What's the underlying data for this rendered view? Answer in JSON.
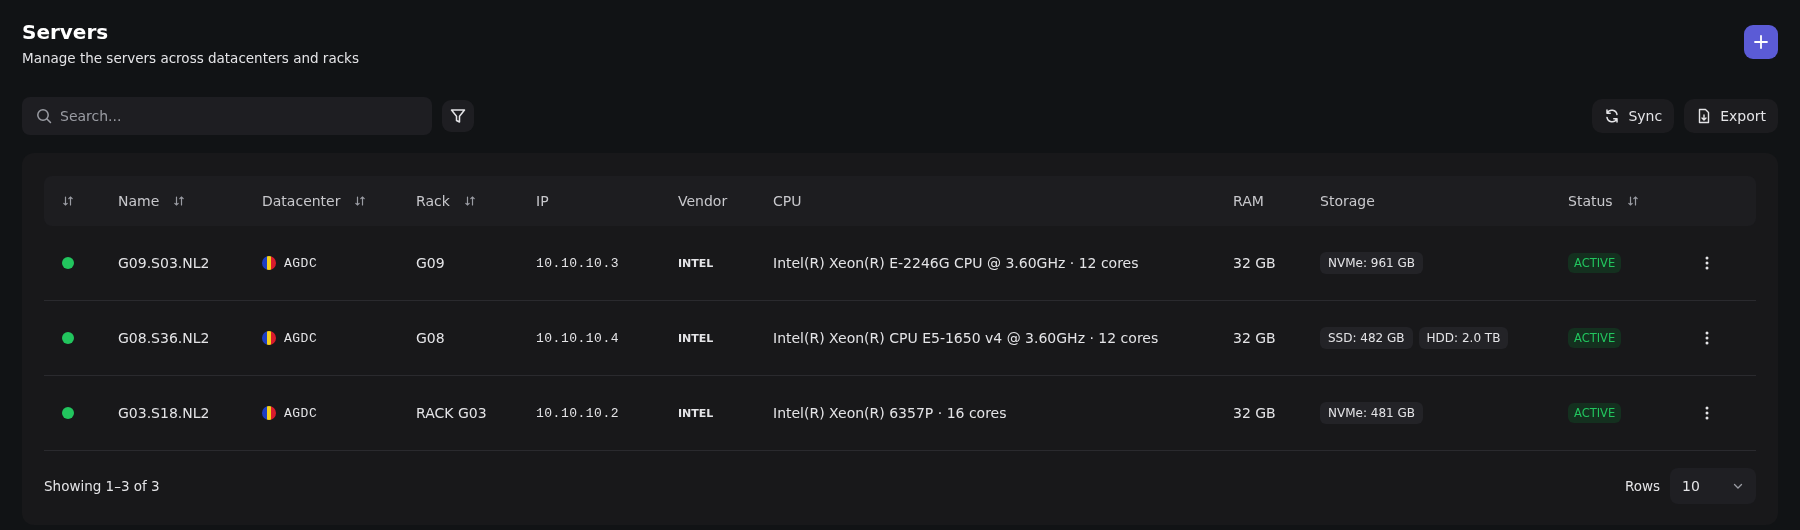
{
  "header": {
    "title": "Servers",
    "subtitle": "Manage the servers across datacenters and racks"
  },
  "search": {
    "placeholder": "Search..."
  },
  "actions": [
    "Sync",
    "Export"
  ],
  "table": {
    "columns": [
      {
        "sortable": true
      },
      {
        "label": "Name",
        "sortable": true
      },
      {
        "label": "Datacenter",
        "sortable": true
      },
      {
        "label": "Rack",
        "sortable": true
      },
      {
        "label": "IP",
        "sortable": false
      },
      {
        "label": "Vendor",
        "sortable": false
      },
      {
        "label": "CPU",
        "sortable": false
      },
      {
        "label": "RAM",
        "sortable": false
      },
      {
        "label": "Storage",
        "sortable": false
      },
      {
        "label": "Status",
        "sortable": true
      },
      {
        "sortable": false
      }
    ],
    "rows": [
      {
        "online": true,
        "name": "G09.S03.NL2",
        "datacenter": "AGDC",
        "rack": "G09",
        "ip": "10.10.10.3",
        "vendor": "INTEL",
        "cpu": "Intel(R) Xeon(R) E-2246G CPU @ 3.60GHz · 12 cores",
        "ram": "32 GB",
        "storage": [
          "NVMe: 961 GB"
        ],
        "status": "ACTIVE"
      },
      {
        "online": true,
        "name": "G08.S36.NL2",
        "datacenter": "AGDC",
        "rack": "G08",
        "ip": "10.10.10.4",
        "vendor": "INTEL",
        "cpu": "Intel(R) Xeon(R) CPU E5-1650 v4 @ 3.60GHz · 12 cores",
        "ram": "32 GB",
        "storage": [
          "SSD: 482 GB",
          "HDD: 2.0 TB"
        ],
        "status": "ACTIVE"
      },
      {
        "online": true,
        "name": "G03.S18.NL2",
        "datacenter": "AGDC",
        "rack": "RACK G03",
        "ip": "10.10.10.2",
        "vendor": "INTEL",
        "cpu": "Intel(R) Xeon(R) 6357P · 16 cores",
        "ram": "32 GB",
        "storage": [
          "NVMe: 481 GB"
        ],
        "status": "ACTIVE"
      }
    ]
  },
  "footer": {
    "summary": "Showing 1–3 of 3",
    "rows_label": "Rows",
    "rows_value": "10"
  }
}
